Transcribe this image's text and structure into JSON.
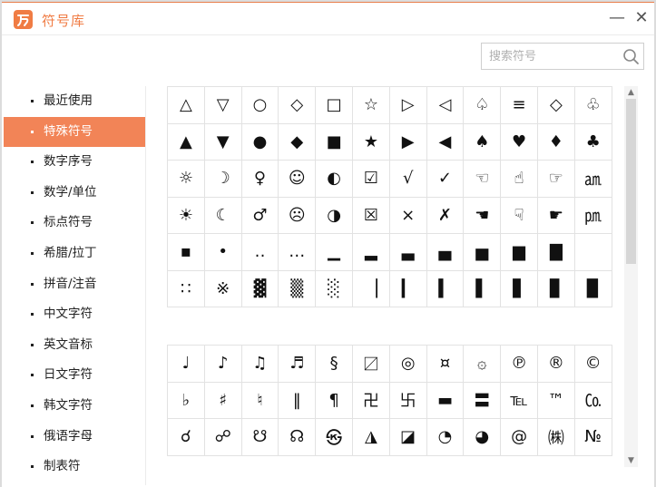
{
  "window": {
    "title": "符号库",
    "minimize": "—",
    "close": "✕"
  },
  "search": {
    "placeholder": "搜索符号",
    "value": ""
  },
  "sidebar": {
    "active_index": 1,
    "items": [
      "最近使用",
      "特殊符号",
      "数字序号",
      "数学/单位",
      "标点符号",
      "希腊/拉丁",
      "拼音/注音",
      "中文字符",
      "英文音标",
      "日文字符",
      "韩文字符",
      "俄语字母",
      "制表符"
    ]
  },
  "symbols_top": [
    [
      "△",
      "▽",
      "○",
      "◇",
      "□",
      "☆",
      "▷",
      "◁",
      "♤",
      "≡",
      "◇",
      "♧"
    ],
    [
      "▲",
      "▼",
      "●",
      "◆",
      "■",
      "★",
      "▶",
      "◀",
      "♠",
      "♥",
      "♦",
      "♣"
    ],
    [
      "☼",
      "☽",
      "♀",
      "☺",
      "◐",
      "☑",
      "√",
      "✓",
      "☜",
      "☝",
      "☞",
      "㏂"
    ],
    [
      "☀",
      "☾",
      "♂",
      "☹",
      "◑",
      "☒",
      "×",
      "✗",
      "☚",
      "☟",
      "☛",
      "㏘"
    ],
    [
      "▪",
      "•",
      "‥",
      "…",
      "▁",
      "▂",
      "▃",
      "▄",
      "▅",
      "▆",
      "▇"
    ],
    [
      "∷",
      "※",
      "▓",
      "▒",
      "░",
      "▕",
      "▎",
      "▍",
      "▌",
      "▋",
      "▊",
      "▉"
    ]
  ],
  "symbols_bottom": [
    [
      "♩",
      "♪",
      "♫",
      "♬",
      "§",
      "〼",
      "◎",
      "¤",
      "۞",
      "℗",
      "®",
      "©"
    ],
    [
      "♭",
      "♯",
      "♮",
      "‖",
      "¶",
      "卍",
      "卐",
      "▬",
      "〓",
      "℡",
      "™",
      "㏇"
    ],
    [
      "☌",
      "☍",
      "☋",
      "☊",
      "㉿",
      "◮",
      "◪",
      "◔",
      "◕",
      "@",
      "㈱",
      "№"
    ]
  ]
}
